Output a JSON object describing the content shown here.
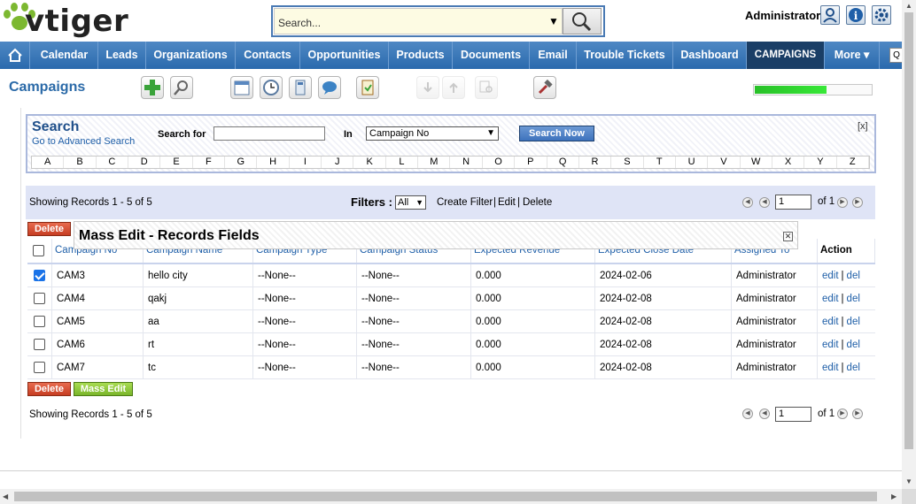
{
  "header": {
    "logo_text": "vtiger",
    "search_value": "Search...",
    "admin_name": "Administrator",
    "icons": [
      "user-icon",
      "info-icon",
      "gear-icon"
    ]
  },
  "nav": {
    "items": [
      "Calendar",
      "Leads",
      "Organizations",
      "Contacts",
      "Opportunities",
      "Products",
      "Documents",
      "Email",
      "Trouble Tickets",
      "Dashboard",
      "CAMPAIGNS",
      "More ▾"
    ],
    "active": "CAMPAIGNS"
  },
  "module": {
    "title": "Campaigns",
    "progress_fraction": 0.62
  },
  "search_panel": {
    "title": "Search",
    "advanced_link": "Go to Advanced Search",
    "search_for_label": "Search for",
    "in_label": "In",
    "field_select": "Campaign No",
    "button": "Search Now",
    "close": "[x]",
    "alphabet": [
      "A",
      "B",
      "C",
      "D",
      "E",
      "F",
      "G",
      "H",
      "I",
      "J",
      "K",
      "L",
      "M",
      "N",
      "O",
      "P",
      "Q",
      "R",
      "S",
      "T",
      "U",
      "V",
      "W",
      "X",
      "Y",
      "Z"
    ]
  },
  "records": {
    "showing_text": "Showing Records 1 - 5 of 5",
    "filters_label": "Filters :",
    "filter_value": "All",
    "create_filter": "Create Filter",
    "edit": "Edit",
    "delete": "Delete",
    "sep": "|",
    "page_value": "1",
    "of_pages": "of 1"
  },
  "buttons": {
    "delete": "Delete",
    "mass_edit": "Mass Edit"
  },
  "mass_edit_popup": {
    "title": "Mass Edit - Records Fields"
  },
  "table": {
    "columns": [
      "Campaign No",
      "Campaign Name",
      "Campaign Type",
      "Campaign Status",
      "Expected Revenue",
      "Expected Close Date",
      "Assigned To",
      "Action"
    ],
    "rows": [
      {
        "checked": true,
        "no": "CAM3",
        "name": "hello city",
        "type": "--None--",
        "status": "--None--",
        "revenue": "0.000",
        "close_date": "2024-02-06",
        "assigned": "Administrator",
        "edit": "edit",
        "del": "del"
      },
      {
        "checked": false,
        "no": "CAM4",
        "name": "qakj",
        "type": "--None--",
        "status": "--None--",
        "revenue": "0.000",
        "close_date": "2024-02-08",
        "assigned": "Administrator",
        "edit": "edit",
        "del": "del"
      },
      {
        "checked": false,
        "no": "CAM5",
        "name": "aa",
        "type": "--None--",
        "status": "--None--",
        "revenue": "0.000",
        "close_date": "2024-02-08",
        "assigned": "Administrator",
        "edit": "edit",
        "del": "del"
      },
      {
        "checked": false,
        "no": "CAM6",
        "name": "rt",
        "type": "--None--",
        "status": "--None--",
        "revenue": "0.000",
        "close_date": "2024-02-08",
        "assigned": "Administrator",
        "edit": "edit",
        "del": "del"
      },
      {
        "checked": false,
        "no": "CAM7",
        "name": "tc",
        "type": "--None--",
        "status": "--None--",
        "revenue": "0.000",
        "close_date": "2024-02-08",
        "assigned": "Administrator",
        "edit": "edit",
        "del": "del"
      }
    ]
  }
}
